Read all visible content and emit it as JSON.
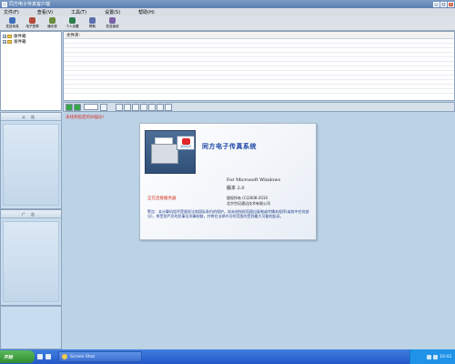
{
  "window": {
    "title": "同方电子传真客户端",
    "buttons": [
      "_",
      "□",
      "x"
    ]
  },
  "menu": [
    "文件(F)",
    "查看(V)",
    "工具(T)",
    "设置(S)",
    "帮助(H)"
  ],
  "toolbar": [
    {
      "label": "发送传真",
      "icon": "send-fax-icon",
      "color": "#3f6fb8"
    },
    {
      "label": "电子签章",
      "icon": "seal-icon",
      "color": "#b64a3c"
    },
    {
      "label": "通讯录",
      "icon": "address-book-icon",
      "color": "#6a8e3d"
    },
    {
      "label": "个人设置",
      "icon": "user-settings-icon",
      "color": "#2f7d4f"
    },
    {
      "label": "帮助",
      "icon": "help-icon",
      "color": "#5a6fae"
    },
    {
      "label": "发送接收",
      "icon": "send-receive-icon",
      "color": "#7c62a8"
    }
  ],
  "tree": [
    {
      "toggle": "+",
      "label": "收件箱"
    },
    {
      "toggle": "+",
      "label": "发件箱"
    }
  ],
  "filelist": {
    "header": "文件夹:"
  },
  "left_panels": [
    {
      "title": "公告"
    },
    {
      "title": "广告"
    }
  ],
  "status_message": "未找到指定的扫描仪!",
  "splash": {
    "brand": "同方电子传真系统",
    "fax_badge": "清华同方",
    "for_line": "For Microsoft Windows",
    "version": "版本 2.0",
    "status": "正在连接服务器",
    "copyright_1": "版权所有 (C)2008-2010",
    "copyright_2": "北京世纪通达技术有限公司",
    "warning": "警告：本计算机程序受版权法和国际条约的保护。如未经授权而擅自复制或传播本程序(或其中任何部分)，将受到严厉的民事及刑事制裁，并将在法律许可的范围内受到最大可能的起诉。"
  },
  "taskbar": {
    "start": "开始",
    "task_label": "Screen Shot",
    "clock": "10:43"
  },
  "colors": {
    "status_red": "#e0261e",
    "brand_blue": "#1b45a6"
  }
}
